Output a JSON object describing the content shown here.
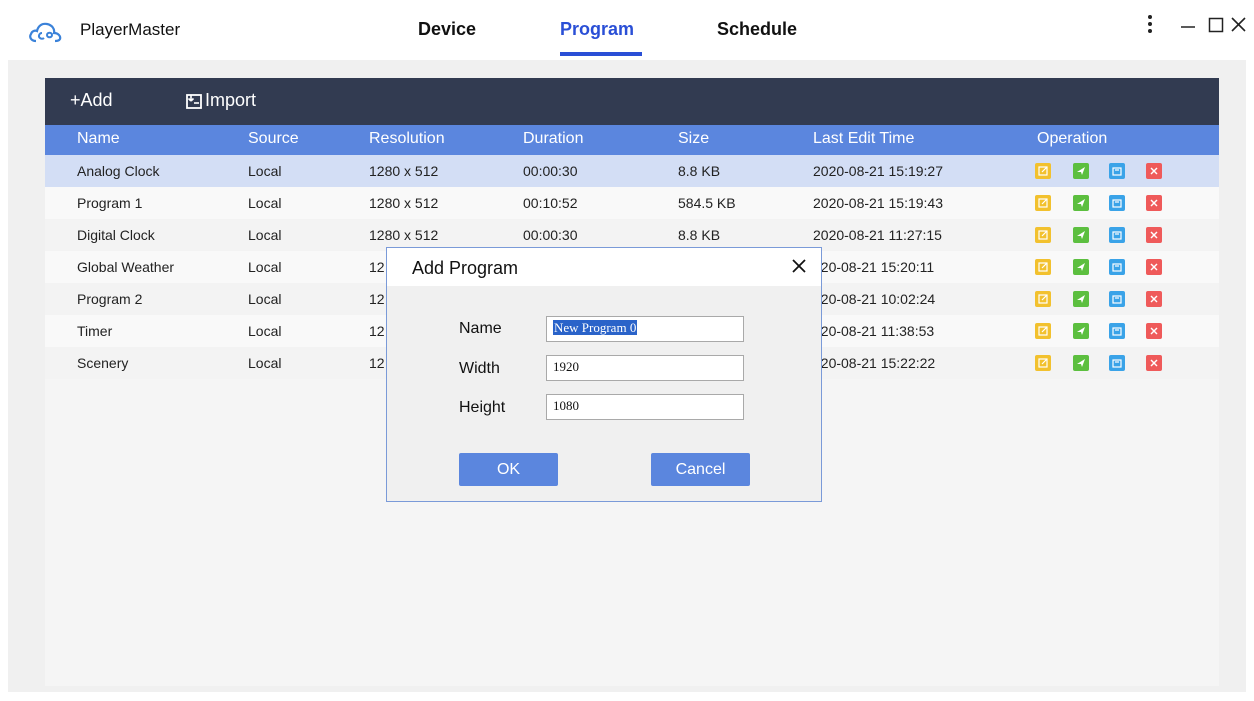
{
  "app": {
    "name": "PlayerMaster"
  },
  "nav": {
    "tabs": [
      "Device",
      "Program",
      "Schedule"
    ],
    "active": "Program"
  },
  "toolbar": {
    "add_label": "+Add",
    "import_label": "Import"
  },
  "table": {
    "columns": [
      "Name",
      "Source",
      "Resolution",
      "Duration",
      "Size",
      "Last Edit Time",
      "Operation"
    ],
    "rows": [
      [
        "Analog Clock",
        "Local",
        "1280 x 512",
        "00:00:30",
        "8.8 KB",
        "2020-08-21 15:19:27"
      ],
      [
        "Program 1",
        "Local",
        "1280 x 512",
        "00:10:52",
        "584.5 KB",
        "2020-08-21 15:19:43"
      ],
      [
        "Digital Clock",
        "Local",
        "1280 x 512",
        "00:00:30",
        "8.8 KB",
        "2020-08-21 11:27:15"
      ],
      [
        "Global Weather",
        "Local",
        "12",
        "",
        "",
        "020-08-21 15:20:11"
      ],
      [
        "Program 2",
        "Local",
        "12",
        "",
        "",
        "020-08-21 10:02:24"
      ],
      [
        "Timer",
        "Local",
        "12",
        "",
        "",
        "020-08-21 11:38:53"
      ],
      [
        "Scenery",
        "Local",
        "12",
        "",
        "",
        "020-08-21 15:22:22"
      ]
    ],
    "selected_row": 0,
    "operation_icons": [
      "edit-icon",
      "send-icon",
      "export-icon",
      "delete-icon"
    ],
    "operation_colors": [
      "#f2c12e",
      "#5cbf3f",
      "#3aa3e8",
      "#ef5a5a"
    ]
  },
  "dialog": {
    "title": "Add Program",
    "fields": [
      {
        "label": "Name",
        "value": "New Program 0"
      },
      {
        "label": "Width",
        "value": "1920"
      },
      {
        "label": "Height",
        "value": "1080"
      }
    ],
    "ok_label": "OK",
    "cancel_label": "Cancel"
  },
  "colors": {
    "accent": "#2a4fd6",
    "toolbar_bg": "#323b51",
    "header_bg": "#5b86de",
    "selected_row": "#d3def5"
  }
}
